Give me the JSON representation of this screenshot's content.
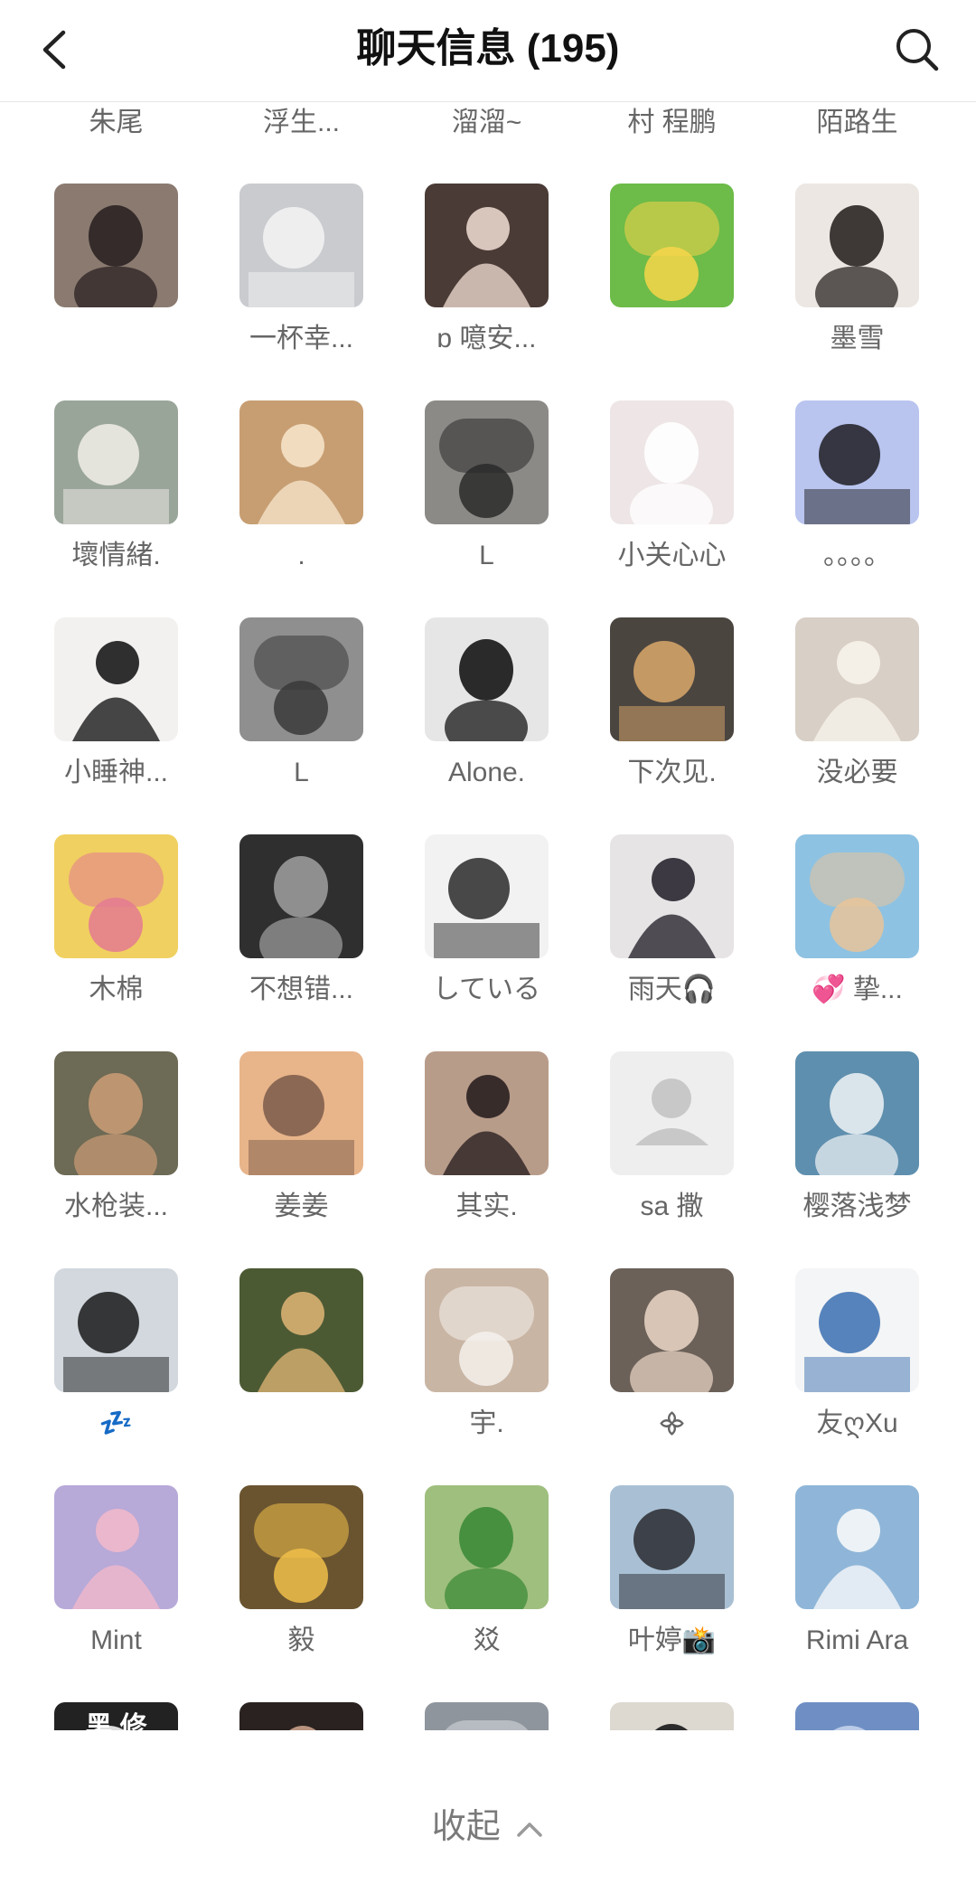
{
  "header": {
    "title": "聊天信息 (195)",
    "back_icon": "chevron-left-icon",
    "search_icon": "search-icon"
  },
  "top_row_names": [
    "朱尾",
    "浮生...",
    "溜溜~",
    "村  程鹏",
    "陌路生"
  ],
  "members": [
    {
      "name": "",
      "bg": "#8a7a70",
      "fg": "#2a2222"
    },
    {
      "name": "一杯幸...",
      "bg": "#c9cbcf",
      "fg": "#f4f4f4"
    },
    {
      "name": "ɒ 噫安...",
      "bg": "#4a3b36",
      "fg": "#e8d6cc"
    },
    {
      "name": "",
      "bg": "#6dbb48",
      "fg": "#f6d64a"
    },
    {
      "name": "墨雪",
      "bg": "#ece7e2",
      "fg": "#2b2623"
    },
    {
      "name": "壞情緒.",
      "bg": "#9aa59a",
      "fg": "#f1eee8"
    },
    {
      "name": ".",
      "bg": "#c79e72",
      "fg": "#f5e2c8"
    },
    {
      "name": "L",
      "bg": "#8c8a87",
      "fg": "#2a2a2a"
    },
    {
      "name": "小关心心",
      "bg": "#eee6e6",
      "fg": "#ffffff"
    },
    {
      "name": "。。。。",
      "bg": "#b9c4ef",
      "fg": "#1d1d22"
    },
    {
      "name": "小睡神...",
      "bg": "#f3f1f0",
      "fg": "#1a1a1a"
    },
    {
      "name": "L",
      "bg": "#8f8f8f",
      "fg": "#3a3a3a"
    },
    {
      "name": "Alone.",
      "bg": "#e6e6e6",
      "fg": "#151515"
    },
    {
      "name": "下次见.",
      "bg": "#4b4540",
      "fg": "#d9a86a"
    },
    {
      "name": "没必要",
      "bg": "#d8cfc6",
      "fg": "#f7f2ea"
    },
    {
      "name": "木棉",
      "bg": "#f0d060",
      "fg": "#e47a92"
    },
    {
      "name": "不想错...",
      "bg": "#2f2f2f",
      "fg": "#9a9a9a"
    },
    {
      "name": "している",
      "bg": "#f2f2f2",
      "fg": "#2a2a2a"
    },
    {
      "name": "雨天🎧",
      "bg": "#e7e4e6",
      "fg": "#2a2630"
    },
    {
      "name": "💞 挚...",
      "bg": "#8ec2e2",
      "fg": "#e8c49a"
    },
    {
      "name": "水枪装...",
      "bg": "#6d6a55",
      "fg": "#c59a74"
    },
    {
      "name": "姜姜",
      "bg": "#e8b48a",
      "fg": "#7a5a4a"
    },
    {
      "name": "其实.",
      "bg": "#b89c8a",
      "fg": "#2a2020"
    },
    {
      "name": "sa 撒",
      "bg": "#eeeeee",
      "fg": "#c8c8c8"
    },
    {
      "name": "樱落浅梦",
      "bg": "#5f8fae",
      "fg": "#e8eef2"
    },
    {
      "name": "💤",
      "bg": "#d2d8de",
      "fg": "#1a1a1a"
    },
    {
      "name": "",
      "bg": "#4c5a34",
      "fg": "#d8b072"
    },
    {
      "name": "宇.",
      "bg": "#c9b5a4",
      "fg": "#f4f1ec"
    },
    {
      "name": "᯽",
      "bg": "#6b6159",
      "fg": "#e4d0c0"
    },
    {
      "name": "友ღXu",
      "bg": "#f4f5f6",
      "fg": "#3a6fb0"
    },
    {
      "name": "Mint",
      "bg": "#b7a9d8",
      "fg": "#f0b8cc"
    },
    {
      "name": "毅",
      "bg": "#6a5430",
      "fg": "#f0c04a"
    },
    {
      "name": "㸚",
      "bg": "#9fbf7e",
      "fg": "#3d8b3a"
    },
    {
      "name": "叶婷📸",
      "bg": "#a9c0d4",
      "fg": "#2a2a30"
    },
    {
      "name": "Rimi Ara",
      "bg": "#8fb6d8",
      "fg": "#f6f8fa"
    }
  ],
  "partial_row": [
    {
      "bg": "#222222",
      "fg": "#ffffff",
      "text": "黑 修"
    },
    {
      "bg": "#2a2220",
      "fg": "#c8a088",
      "text": ""
    },
    {
      "bg": "#8e959c",
      "fg": "#d8dde2",
      "text": ""
    },
    {
      "bg": "#ddd8d0",
      "fg": "#1a1a1a",
      "text": ""
    },
    {
      "bg": "#6f8fc4",
      "fg": "#c9d6ee",
      "text": ""
    }
  ],
  "footer": {
    "collapse_label": "收起",
    "collapse_icon": "chevron-up-icon"
  }
}
